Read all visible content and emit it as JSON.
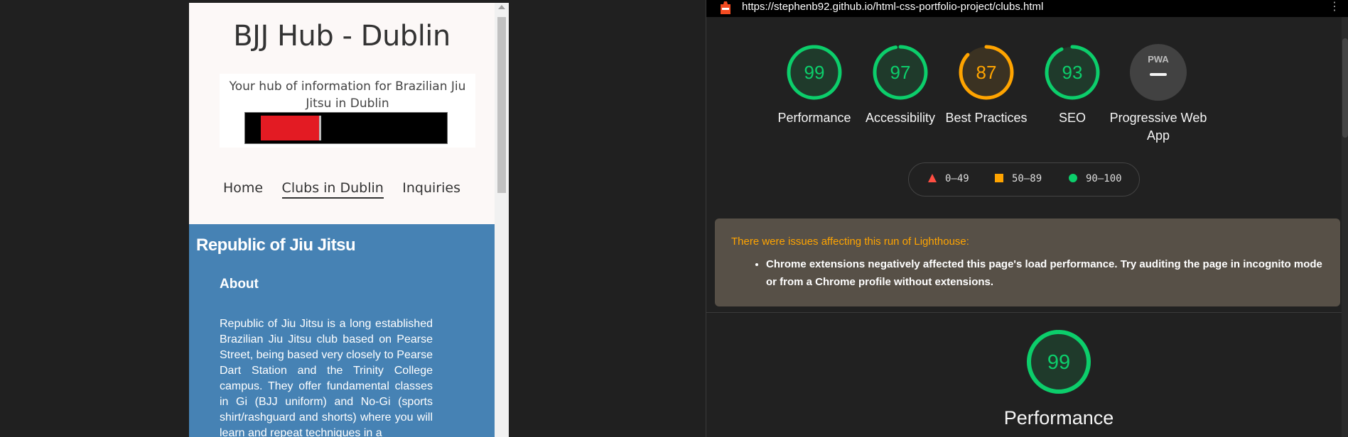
{
  "mobile": {
    "site_title": "BJJ Hub - Dublin",
    "tagline": "Your hub of information for Brazilian Jiu Jitsu in Dublin",
    "nav": [
      "Home",
      "Clubs in Dublin",
      "Inquiries"
    ],
    "active_nav": "Clubs in Dublin",
    "club": {
      "name": "Republic of Jiu Jitsu",
      "about_heading": "About",
      "about_text": "Republic of Jiu Jitsu is a long established Brazilian Jiu Jitsu club based on Pearse Street, being based very closely to Pearse Dart Station and the Trinity College campus. They offer fundamental classes in Gi (BJJ uniform) and No-Gi (sports shirt/rashguard and shorts) where you will learn and repeat techniques in a"
    }
  },
  "lighthouse": {
    "url": "https://stephenb92.github.io/html-css-portfolio-project/clubs.html",
    "scores": [
      {
        "label": "Performance",
        "value": "99",
        "status": "pass"
      },
      {
        "label": "Accessibility",
        "value": "97",
        "status": "pass"
      },
      {
        "label": "Best Practices",
        "value": "87",
        "status": "average"
      },
      {
        "label": "SEO",
        "value": "93",
        "status": "pass"
      },
      {
        "label": "Progressive Web App",
        "value": "PWA",
        "status": "na"
      }
    ],
    "legend": [
      "0–49",
      "50–89",
      "90–100"
    ],
    "warning_title": "There were issues affecting this run of Lighthouse:",
    "warning_item": "Chrome extensions negatively affected this page's load performance. Try auditing the page in incognito mode or from a Chrome profile without extensions.",
    "section_score": {
      "label": "Performance",
      "value": "99"
    },
    "colors": {
      "pass": "#0cce6b",
      "average": "#ffa400",
      "fail": "#ff4e42",
      "na": "#9e9e9e"
    }
  }
}
